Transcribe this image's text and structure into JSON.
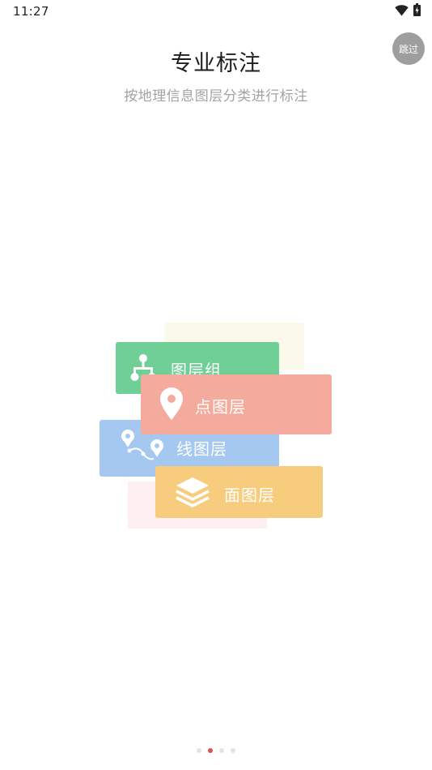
{
  "status_bar": {
    "time": "11:27",
    "icons": [
      "wifi-icon",
      "battery-charging-icon"
    ]
  },
  "skip_button": {
    "label": "跳过"
  },
  "header": {
    "title": "专业标注",
    "subtitle": "按地理信息图层分类进行标注"
  },
  "illustration": {
    "cards": [
      {
        "id": "group",
        "label": "图层组",
        "icon": "hierarchy-icon",
        "color": "#6fcf97"
      },
      {
        "id": "point",
        "label": "点图层",
        "icon": "map-pin-icon",
        "color": "#f4ab9d"
      },
      {
        "id": "line",
        "label": "线图层",
        "icon": "route-icon",
        "color": "#a4c8f0"
      },
      {
        "id": "area",
        "label": "面图层",
        "icon": "layers-icon",
        "color": "#f8cc7d"
      }
    ]
  },
  "pager": {
    "total": 4,
    "active": 2,
    "active_color": "#d9534f"
  }
}
